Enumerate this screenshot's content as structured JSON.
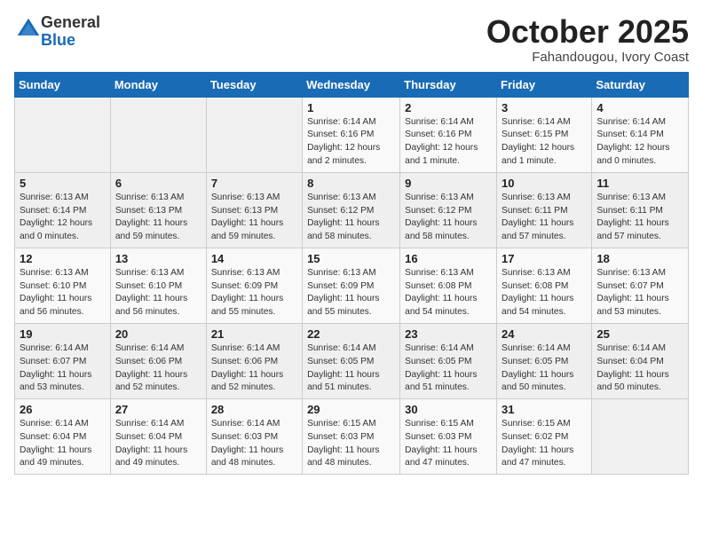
{
  "header": {
    "logo_general": "General",
    "logo_blue": "Blue",
    "month_title": "October 2025",
    "location": "Fahandougou, Ivory Coast"
  },
  "weekdays": [
    "Sunday",
    "Monday",
    "Tuesday",
    "Wednesday",
    "Thursday",
    "Friday",
    "Saturday"
  ],
  "weeks": [
    [
      {
        "day": "",
        "info": ""
      },
      {
        "day": "",
        "info": ""
      },
      {
        "day": "",
        "info": ""
      },
      {
        "day": "1",
        "info": "Sunrise: 6:14 AM\nSunset: 6:16 PM\nDaylight: 12 hours\nand 2 minutes."
      },
      {
        "day": "2",
        "info": "Sunrise: 6:14 AM\nSunset: 6:16 PM\nDaylight: 12 hours\nand 1 minute."
      },
      {
        "day": "3",
        "info": "Sunrise: 6:14 AM\nSunset: 6:15 PM\nDaylight: 12 hours\nand 1 minute."
      },
      {
        "day": "4",
        "info": "Sunrise: 6:14 AM\nSunset: 6:14 PM\nDaylight: 12 hours\nand 0 minutes."
      }
    ],
    [
      {
        "day": "5",
        "info": "Sunrise: 6:13 AM\nSunset: 6:14 PM\nDaylight: 12 hours\nand 0 minutes."
      },
      {
        "day": "6",
        "info": "Sunrise: 6:13 AM\nSunset: 6:13 PM\nDaylight: 11 hours\nand 59 minutes."
      },
      {
        "day": "7",
        "info": "Sunrise: 6:13 AM\nSunset: 6:13 PM\nDaylight: 11 hours\nand 59 minutes."
      },
      {
        "day": "8",
        "info": "Sunrise: 6:13 AM\nSunset: 6:12 PM\nDaylight: 11 hours\nand 58 minutes."
      },
      {
        "day": "9",
        "info": "Sunrise: 6:13 AM\nSunset: 6:12 PM\nDaylight: 11 hours\nand 58 minutes."
      },
      {
        "day": "10",
        "info": "Sunrise: 6:13 AM\nSunset: 6:11 PM\nDaylight: 11 hours\nand 57 minutes."
      },
      {
        "day": "11",
        "info": "Sunrise: 6:13 AM\nSunset: 6:11 PM\nDaylight: 11 hours\nand 57 minutes."
      }
    ],
    [
      {
        "day": "12",
        "info": "Sunrise: 6:13 AM\nSunset: 6:10 PM\nDaylight: 11 hours\nand 56 minutes."
      },
      {
        "day": "13",
        "info": "Sunrise: 6:13 AM\nSunset: 6:10 PM\nDaylight: 11 hours\nand 56 minutes."
      },
      {
        "day": "14",
        "info": "Sunrise: 6:13 AM\nSunset: 6:09 PM\nDaylight: 11 hours\nand 55 minutes."
      },
      {
        "day": "15",
        "info": "Sunrise: 6:13 AM\nSunset: 6:09 PM\nDaylight: 11 hours\nand 55 minutes."
      },
      {
        "day": "16",
        "info": "Sunrise: 6:13 AM\nSunset: 6:08 PM\nDaylight: 11 hours\nand 54 minutes."
      },
      {
        "day": "17",
        "info": "Sunrise: 6:13 AM\nSunset: 6:08 PM\nDaylight: 11 hours\nand 54 minutes."
      },
      {
        "day": "18",
        "info": "Sunrise: 6:13 AM\nSunset: 6:07 PM\nDaylight: 11 hours\nand 53 minutes."
      }
    ],
    [
      {
        "day": "19",
        "info": "Sunrise: 6:14 AM\nSunset: 6:07 PM\nDaylight: 11 hours\nand 53 minutes."
      },
      {
        "day": "20",
        "info": "Sunrise: 6:14 AM\nSunset: 6:06 PM\nDaylight: 11 hours\nand 52 minutes."
      },
      {
        "day": "21",
        "info": "Sunrise: 6:14 AM\nSunset: 6:06 PM\nDaylight: 11 hours\nand 52 minutes."
      },
      {
        "day": "22",
        "info": "Sunrise: 6:14 AM\nSunset: 6:05 PM\nDaylight: 11 hours\nand 51 minutes."
      },
      {
        "day": "23",
        "info": "Sunrise: 6:14 AM\nSunset: 6:05 PM\nDaylight: 11 hours\nand 51 minutes."
      },
      {
        "day": "24",
        "info": "Sunrise: 6:14 AM\nSunset: 6:05 PM\nDaylight: 11 hours\nand 50 minutes."
      },
      {
        "day": "25",
        "info": "Sunrise: 6:14 AM\nSunset: 6:04 PM\nDaylight: 11 hours\nand 50 minutes."
      }
    ],
    [
      {
        "day": "26",
        "info": "Sunrise: 6:14 AM\nSunset: 6:04 PM\nDaylight: 11 hours\nand 49 minutes."
      },
      {
        "day": "27",
        "info": "Sunrise: 6:14 AM\nSunset: 6:04 PM\nDaylight: 11 hours\nand 49 minutes."
      },
      {
        "day": "28",
        "info": "Sunrise: 6:14 AM\nSunset: 6:03 PM\nDaylight: 11 hours\nand 48 minutes."
      },
      {
        "day": "29",
        "info": "Sunrise: 6:15 AM\nSunset: 6:03 PM\nDaylight: 11 hours\nand 48 minutes."
      },
      {
        "day": "30",
        "info": "Sunrise: 6:15 AM\nSunset: 6:03 PM\nDaylight: 11 hours\nand 47 minutes."
      },
      {
        "day": "31",
        "info": "Sunrise: 6:15 AM\nSunset: 6:02 PM\nDaylight: 11 hours\nand 47 minutes."
      },
      {
        "day": "",
        "info": ""
      }
    ]
  ]
}
